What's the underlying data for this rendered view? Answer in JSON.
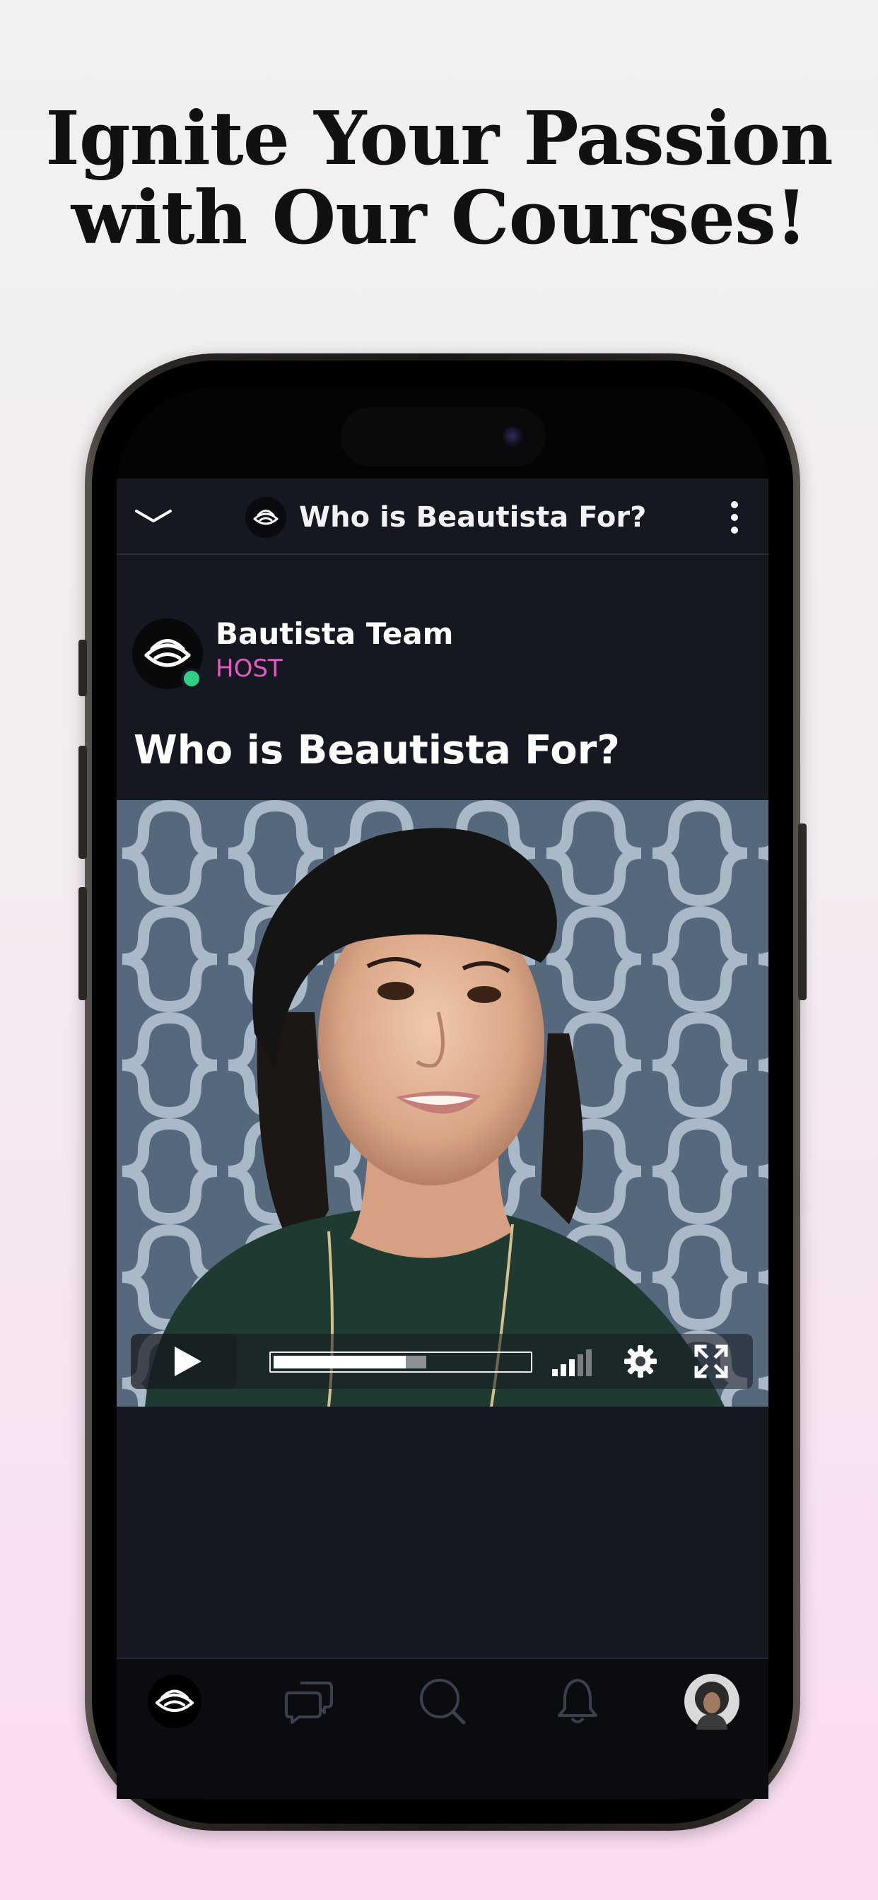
{
  "headline": {
    "line1": "Ignite Your Passion",
    "line2": "with Our Courses!"
  },
  "topbar": {
    "back_icon": "chevron-down-icon",
    "title": "Who is Beautista For?",
    "menu_icon": "more-vertical-icon"
  },
  "post": {
    "author_name": "Bautista Team",
    "author_role": "HOST",
    "title": "Who is Beautista For?"
  },
  "video": {
    "progress": 0.52,
    "buffered": 0.6,
    "volume_level": 0.6
  },
  "bottom_nav": {
    "items": [
      "home-logo-icon",
      "chat-bubbles-icon",
      "search-icon",
      "bell-icon",
      "profile-avatar"
    ]
  },
  "colors": {
    "background": "#151820",
    "accent_pink": "#e05cc0",
    "online_green": "#2fd084",
    "nav_icon": "#3b404c"
  }
}
